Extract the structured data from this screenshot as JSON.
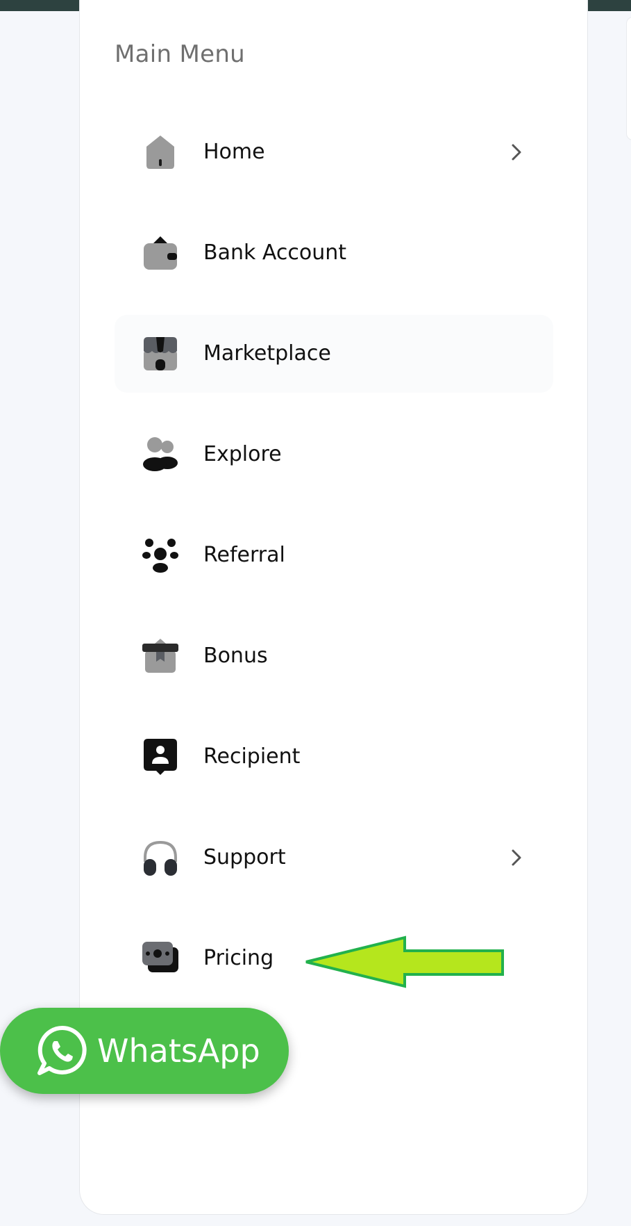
{
  "menu": {
    "title": "Main Menu",
    "items": [
      {
        "label": "Home",
        "icon": "home-icon",
        "has_submenu": true
      },
      {
        "label": "Bank Account",
        "icon": "wallet-icon",
        "has_submenu": false
      },
      {
        "label": "Marketplace",
        "icon": "store-icon",
        "has_submenu": false
      },
      {
        "label": "Explore",
        "icon": "people-icon",
        "has_submenu": false
      },
      {
        "label": "Referral",
        "icon": "group-icon",
        "has_submenu": false
      },
      {
        "label": "Bonus",
        "icon": "gift-icon",
        "has_submenu": false
      },
      {
        "label": "Recipient",
        "icon": "user-card-icon",
        "has_submenu": false
      },
      {
        "label": "Support",
        "icon": "headphones-icon",
        "has_submenu": true
      },
      {
        "label": "Pricing",
        "icon": "money-icon",
        "has_submenu": false
      }
    ]
  },
  "whatsapp": {
    "label": "WhatsApp",
    "icon": "whatsapp-icon",
    "color": "#4cc04a"
  },
  "colors": {
    "topbar": "#2d4240",
    "accent_arrow": "#b5e61d",
    "arrow_outline": "#22b14c"
  }
}
